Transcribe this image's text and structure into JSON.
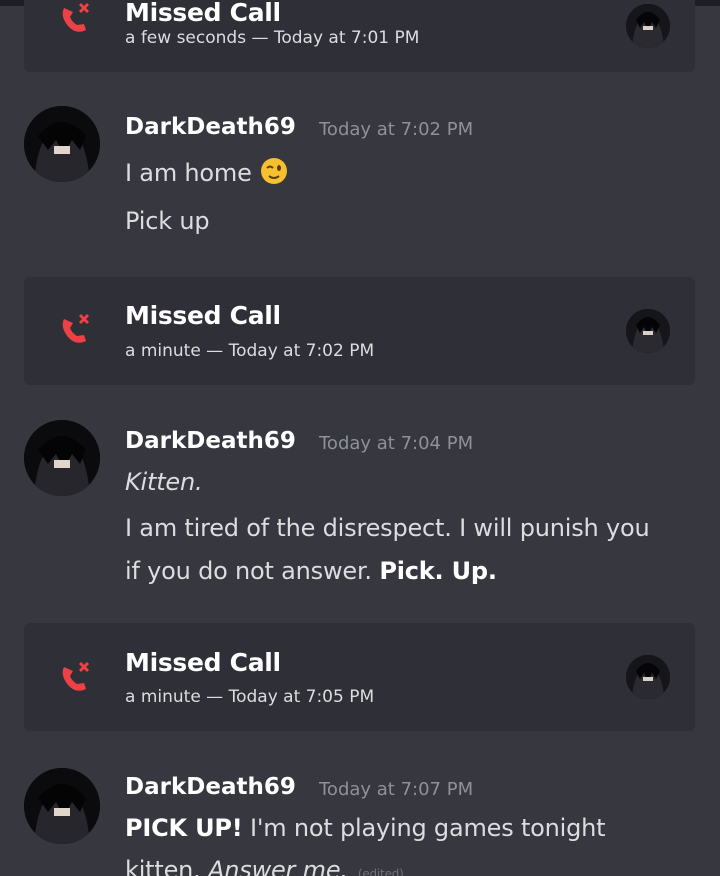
{
  "calls": [
    {
      "title": "Missed Call",
      "meta": "a few seconds — Today at 7:01 PM"
    },
    {
      "title": "Missed Call",
      "meta": "a minute — Today at 7:02 PM"
    },
    {
      "title": "Missed Call",
      "meta": "a minute — Today at 7:05 PM"
    }
  ],
  "messages": [
    {
      "author": "DarkDeath69",
      "time": "Today at 7:02 PM",
      "lines": [
        "I am home",
        "Pick up"
      ]
    },
    {
      "author": "DarkDeath69",
      "time": "Today at 7:04 PM",
      "lines": [
        "Kitten.",
        "I am tired of the disrespect. I will punish you",
        "if you do not answer.",
        "Pick. Up."
      ]
    },
    {
      "author": "DarkDeath69",
      "time": "Today at 7:07 PM",
      "lines": [
        "PICK UP!",
        "I'm not playing games tonight",
        "kitten.",
        "Answer me."
      ],
      "edited": "(edited)"
    }
  ],
  "icons": {
    "missed_call": "missed-call-icon",
    "emoji": "winking-face-icon"
  },
  "colors": {
    "background": "#36373f",
    "card": "#2e2f37",
    "missed_call_red": "#ed4245",
    "username": "#ffffff",
    "timestamp": "#8e9297"
  }
}
